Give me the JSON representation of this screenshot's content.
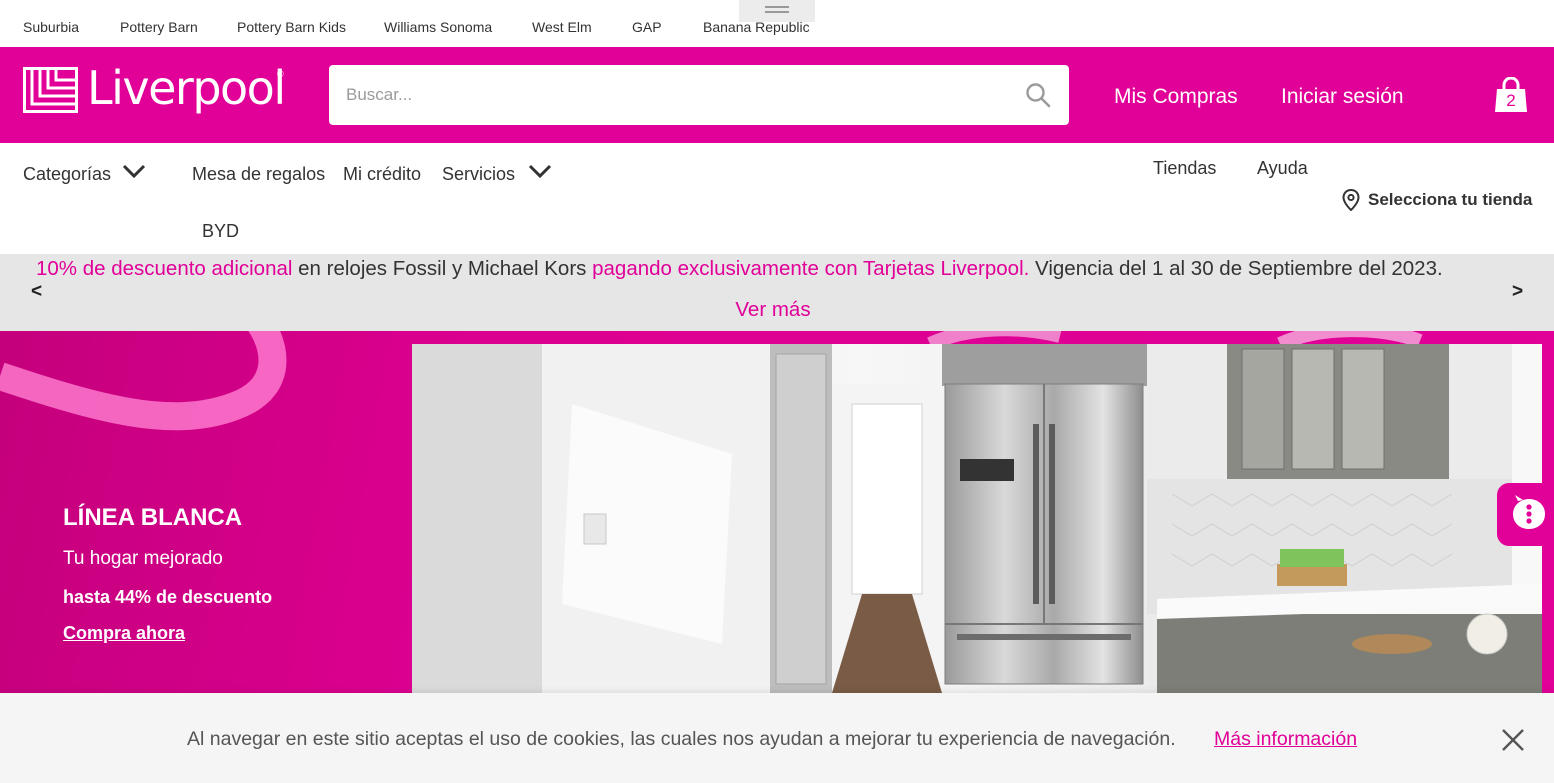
{
  "brand_strip": {
    "links": [
      "Suburbia",
      "Pottery Barn",
      "Pottery Barn Kids",
      "Williams Sonoma",
      "West Elm",
      "GAP",
      "Banana Republic"
    ]
  },
  "header": {
    "logo_text": "Liverpool",
    "search_placeholder": "Buscar...",
    "my_purchases": "Mis Compras",
    "sign_in": "Iniciar sesión",
    "cart_count": "2"
  },
  "nav": {
    "categories": "Categorías",
    "gift_registry": "Mesa de regalos",
    "my_credit": "Mi crédito",
    "services": "Servicios",
    "byd": "BYD",
    "stores": "Tiendas",
    "help": "Ayuda",
    "select_store": "Selecciona tu tienda"
  },
  "promo": {
    "part1": "10% de descuento adicional",
    "part2": "en relojes Fossil y Michael Kors",
    "part3": "pagando exclusivamente con Tarjetas Liverpool.",
    "part4": "Vigencia del 1 al 30 de Septiembre del 2023.",
    "more": "Ver más",
    "prev": "<",
    "next": ">"
  },
  "hero": {
    "title": "LÍNEA BLANCA",
    "subtitle": "Tu hogar mejorado",
    "discount": "hasta 44% de descuento",
    "cta": "Compra ahora"
  },
  "cookie": {
    "text": "Al navegar en este sitio aceptas el uso de cookies, las cuales nos ayudan a mejorar tu experiencia de navegación.",
    "link": "Más información"
  },
  "colors": {
    "brand_pink": "#e10098",
    "promo_bg": "#e6e6e6"
  }
}
